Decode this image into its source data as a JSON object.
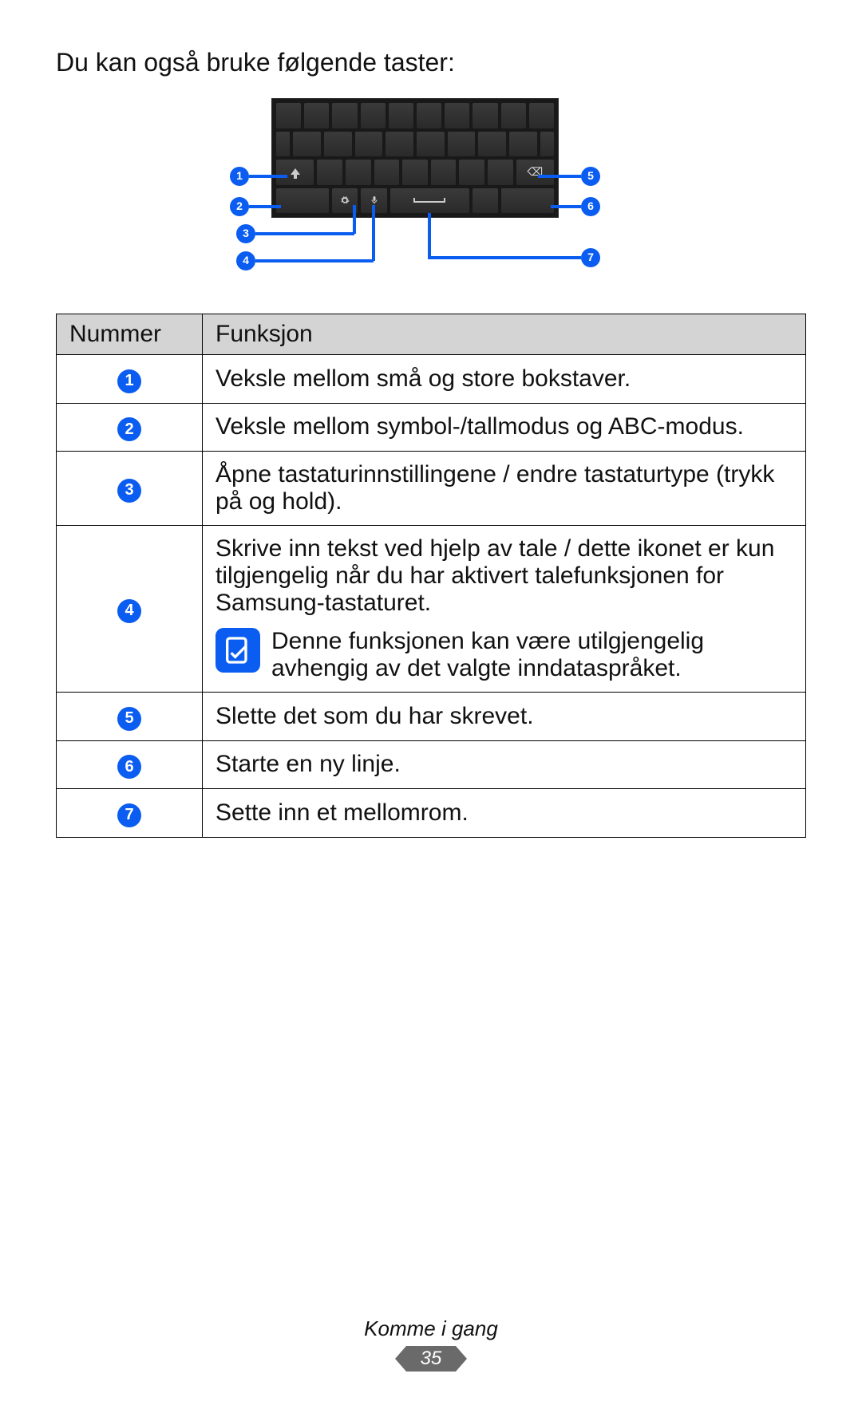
{
  "intro": "Du kan også bruke følgende taster:",
  "callouts": {
    "1": "1",
    "2": "2",
    "3": "3",
    "4": "4",
    "5": "5",
    "6": "6",
    "7": "7"
  },
  "table": {
    "headers": {
      "number": "Nummer",
      "function": "Funksjon"
    },
    "rows": [
      {
        "num": "1",
        "text": "Veksle mellom små og store bokstaver."
      },
      {
        "num": "2",
        "text": "Veksle mellom symbol-/tallmodus og ABC-modus."
      },
      {
        "num": "3",
        "text": "Åpne tastaturinnstillingene / endre tastaturtype (trykk på og hold)."
      },
      {
        "num": "4",
        "text": "Skrive inn tekst ved hjelp av tale / dette ikonet er kun tilgjengelig når du har aktivert talefunksjonen for Samsung-tastaturet.",
        "note": "Denne funksjonen kan være utilgjengelig avhengig av det valgte inndataspråket."
      },
      {
        "num": "5",
        "text": "Slette det som du har skrevet."
      },
      {
        "num": "6",
        "text": "Starte en ny linje."
      },
      {
        "num": "7",
        "text": "Sette inn et mellomrom."
      }
    ]
  },
  "footer": {
    "section": "Komme i gang",
    "page": "35"
  }
}
